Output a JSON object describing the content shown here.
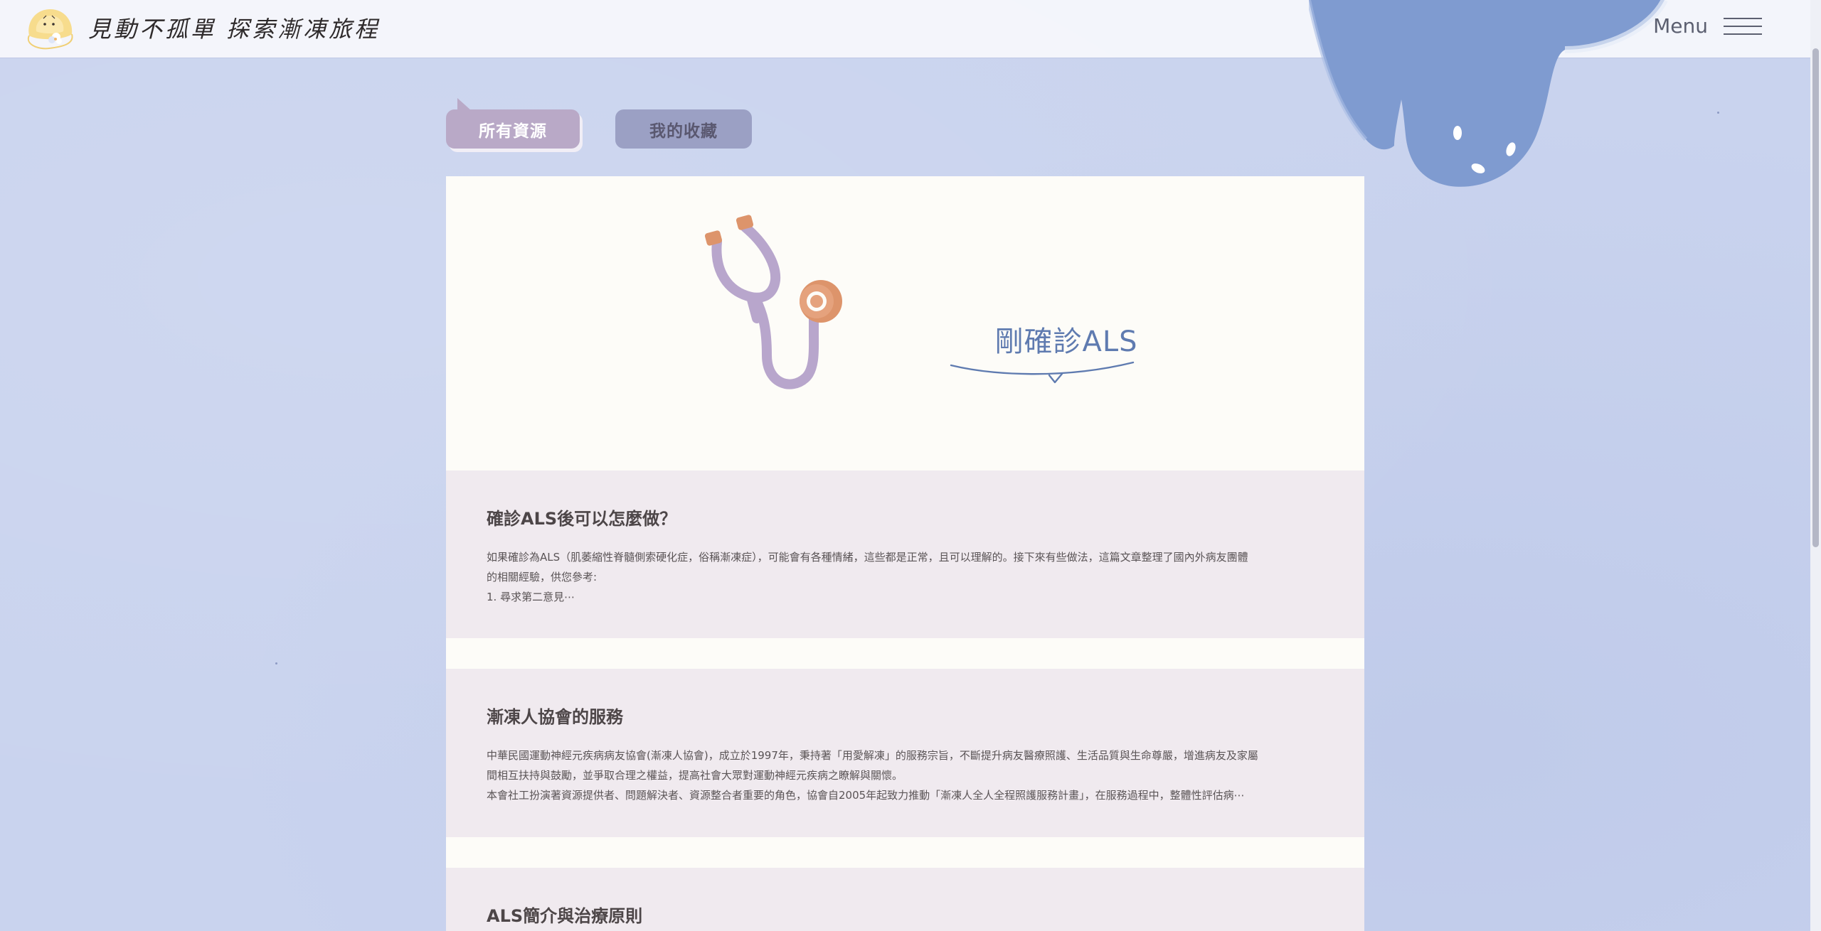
{
  "header": {
    "site_title": "見動不孤單 探索漸凍旅程",
    "menu_label": "Menu",
    "logo_icon": "girl-with-flower-icon"
  },
  "tabs": [
    {
      "label": "所有資源",
      "active": true
    },
    {
      "label": "我的收藏",
      "active": false
    }
  ],
  "hero": {
    "title": "剛確診ALS",
    "icon": "stethoscope-icon"
  },
  "articles": [
    {
      "title": "確診ALS後可以怎麼做？",
      "lines": [
        "如果確診為ALS（肌萎縮性脊髓側索硬化症，俗稱漸凍症），可能會有各種情緒，這些都是正常，且可以理解的。接下來有些做法，這篇文章整理了國內外病友團體",
        "的相關經驗，供您參考:",
        "1. 尋求第二意見⋯"
      ]
    },
    {
      "title": "漸凍人協會的服務",
      "lines": [
        "中華民國運動神經元疾病病友協會(漸凍人協會)，成立於1997年，秉持著「用愛解凍」的服務宗旨，不斷提升病友醫療照護、生活品質與生命尊嚴，增進病友及家屬",
        "間相互扶持與鼓勵，並爭取合理之權益，提高社會大眾對運動神經元疾病之瞭解與關懷。",
        "本會社工扮演著資源提供者、問題解決者、資源整合者重要的角色，協會自2005年起致力推動「漸凍人全人全程照護服務計畫」，在服務過程中，整體性評估病⋯"
      ]
    },
    {
      "title": "ALS簡介與治療原則",
      "lines": []
    }
  ],
  "colors": {
    "background": "#c9d3ee",
    "tab_active": "#b9a9c7",
    "tab_inactive": "#9ba0c4",
    "hero_title": "#5f7bb0",
    "article_bg": "#f0eaef",
    "ghost": "#7f9bd0"
  },
  "decorations": {
    "ghost": "ghost-mascot-icon"
  }
}
